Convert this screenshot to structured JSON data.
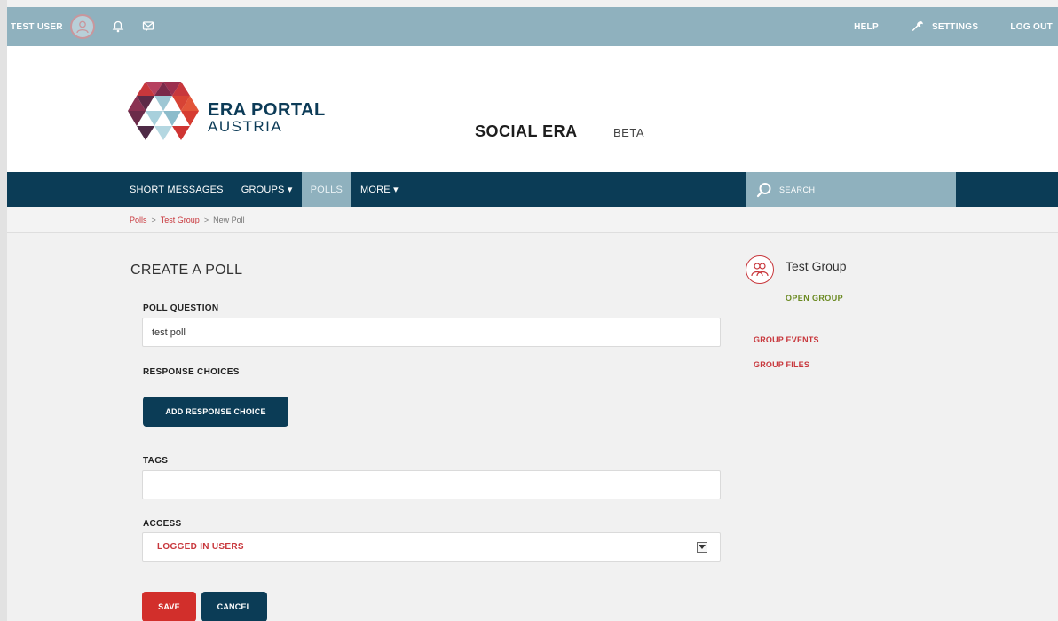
{
  "topbar": {
    "user_name": "TEST USER",
    "help": "HELP",
    "settings": "SETTINGS",
    "logout": "LOG OUT"
  },
  "brand": {
    "logo_line1": "ERA PORTAL",
    "logo_line2": "AUSTRIA",
    "site_title": "SOCIAL ERA",
    "site_badge": "BETA"
  },
  "nav": {
    "items": [
      {
        "label": "SHORT MESSAGES"
      },
      {
        "label": "GROUPS ▾"
      },
      {
        "label": "POLLS",
        "active": true
      },
      {
        "label": "MORE ▾"
      }
    ],
    "search_placeholder": "SEARCH"
  },
  "breadcrumb": {
    "items": [
      "Polls",
      "Test Group",
      "New Poll"
    ],
    "separator": ">"
  },
  "form": {
    "heading": "CREATE A POLL",
    "question_label": "POLL QUESTION",
    "question_value": "test poll",
    "choices_label": "RESPONSE CHOICES",
    "add_choice_button": "ADD RESPONSE CHOICE",
    "tags_label": "TAGS",
    "tags_value": "",
    "access_label": "ACCESS",
    "access_value": "LOGGED IN USERS",
    "save_button": "SAVE",
    "cancel_button": "CANCEL"
  },
  "sidebar": {
    "group_name": "Test Group",
    "group_type": "OPEN GROUP",
    "links": [
      "GROUP EVENTS",
      "GROUP FILES"
    ]
  },
  "colors": {
    "navy": "#0b3c56",
    "steel_blue": "#8fb1be",
    "accent_red": "#c8373c",
    "button_red": "#d22f2b",
    "green": "#6b8a22"
  }
}
